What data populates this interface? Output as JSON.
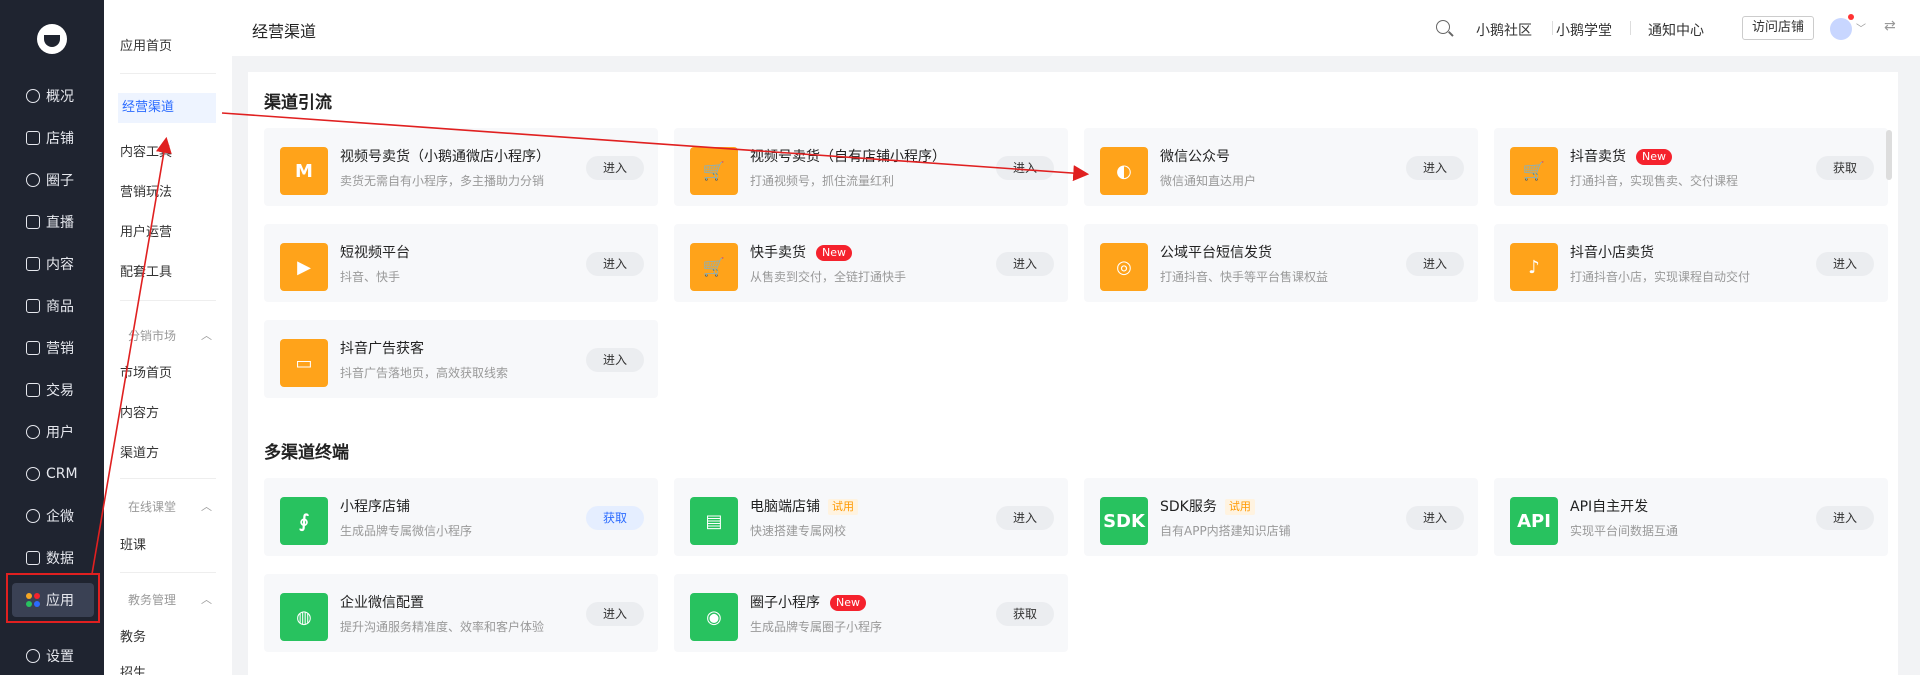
{
  "nav": {
    "items": [
      {
        "label": "概况",
        "icon": "dashboard-icon"
      },
      {
        "label": "店铺",
        "icon": "store-icon"
      },
      {
        "label": "圈子",
        "icon": "circle-icon"
      },
      {
        "label": "直播",
        "icon": "live-icon"
      },
      {
        "label": "内容",
        "icon": "content-icon"
      },
      {
        "label": "商品",
        "icon": "goods-icon"
      },
      {
        "label": "营销",
        "icon": "marketing-icon"
      },
      {
        "label": "交易",
        "icon": "trade-icon"
      },
      {
        "label": "用户",
        "icon": "user-icon"
      },
      {
        "label": "CRM",
        "icon": "crm-icon"
      },
      {
        "label": "企微",
        "icon": "wecom-icon"
      },
      {
        "label": "数据",
        "icon": "data-icon"
      },
      {
        "label": "应用",
        "icon": "apps-icon"
      },
      {
        "label": "设置",
        "icon": "settings-icon"
      }
    ]
  },
  "submenu": {
    "top": [
      "应用首页"
    ],
    "main": [
      "经营渠道",
      "内容工具",
      "营销玩法",
      "用户运营",
      "配套工具"
    ],
    "groups": [
      {
        "title": "分销市场",
        "items": [
          "市场首页",
          "内容方",
          "渠道方"
        ]
      },
      {
        "title": "在线课堂",
        "items": [
          "班课"
        ]
      },
      {
        "title": "教务管理",
        "items": [
          "教务",
          "招生"
        ]
      }
    ]
  },
  "header": {
    "title": "经营渠道",
    "links": [
      "小鹅社区",
      "小鹅学堂",
      "通知中心"
    ],
    "visit_label": "访问店铺"
  },
  "sections": [
    {
      "title": "渠道引流",
      "cards": [
        {
          "title": "视频号卖货（小鹅通微店小程序）",
          "desc": "卖货无需自有小程序，多主播助力分销",
          "btn": "进入",
          "color": "orange",
          "glyph": "M",
          "badge": ""
        },
        {
          "title": "视频号卖货（自有店铺小程序）",
          "desc": "打通视频号，抓住流量红利",
          "btn": "进入",
          "color": "orange",
          "glyph": "🛒",
          "badge": ""
        },
        {
          "title": "微信公众号",
          "desc": "微信通知直达用户",
          "btn": "进入",
          "color": "orange",
          "glyph": "◐",
          "badge": ""
        },
        {
          "title": "抖音卖货",
          "desc": "打通抖音，实现售卖、交付课程",
          "btn": "获取",
          "color": "orange",
          "glyph": "🛒",
          "badge": "New"
        },
        {
          "title": "短视频平台",
          "desc": "抖音、快手",
          "btn": "进入",
          "color": "orange",
          "glyph": "▶",
          "badge": ""
        },
        {
          "title": "快手卖货",
          "desc": "从售卖到交付，全链打通快手",
          "btn": "进入",
          "color": "orange",
          "glyph": "🛒",
          "badge": "New"
        },
        {
          "title": "公域平台短信发货",
          "desc": "打通抖音、快手等平台售课权益",
          "btn": "进入",
          "color": "orange",
          "glyph": "◎",
          "badge": ""
        },
        {
          "title": "抖音小店卖货",
          "desc": "打通抖音小店，实现课程自动交付",
          "btn": "进入",
          "color": "orange",
          "glyph": "♪",
          "badge": ""
        },
        {
          "title": "抖音广告获客",
          "desc": "抖音广告落地页，高效获取线索",
          "btn": "进入",
          "color": "orange",
          "glyph": "▭",
          "badge": ""
        }
      ]
    },
    {
      "title": "多渠道终端",
      "cards": [
        {
          "title": "小程序店铺",
          "desc": "生成品牌专属微信小程序",
          "btn": "获取",
          "btn_style": "blue",
          "color": "green",
          "glyph": "∮",
          "badge": ""
        },
        {
          "title": "电脑端店铺",
          "desc": "快速搭建专属网校",
          "btn": "进入",
          "color": "green",
          "glyph": "▤",
          "badge": "试用"
        },
        {
          "title": "SDK服务",
          "desc": "自有APP内搭建知识店铺",
          "btn": "进入",
          "color": "green",
          "glyph": "SDK",
          "badge": "试用"
        },
        {
          "title": "API自主开发",
          "desc": "实现平台间数据互通",
          "btn": "进入",
          "color": "green",
          "glyph": "API",
          "badge": ""
        },
        {
          "title": "企业微信配置",
          "desc": "提升沟通服务精准度、效率和客户体验",
          "btn": "进入",
          "color": "green",
          "glyph": "◍",
          "badge": ""
        },
        {
          "title": "圈子小程序",
          "desc": "生成品牌专属圈子小程序",
          "btn": "获取",
          "color": "green",
          "glyph": "◉",
          "badge": "New"
        }
      ]
    }
  ],
  "colors": {
    "accent": "#2b6bff",
    "orange": "#ffa31a",
    "green": "#28c25f",
    "annotation": "#e02020",
    "nav_bg": "#1f2430"
  }
}
